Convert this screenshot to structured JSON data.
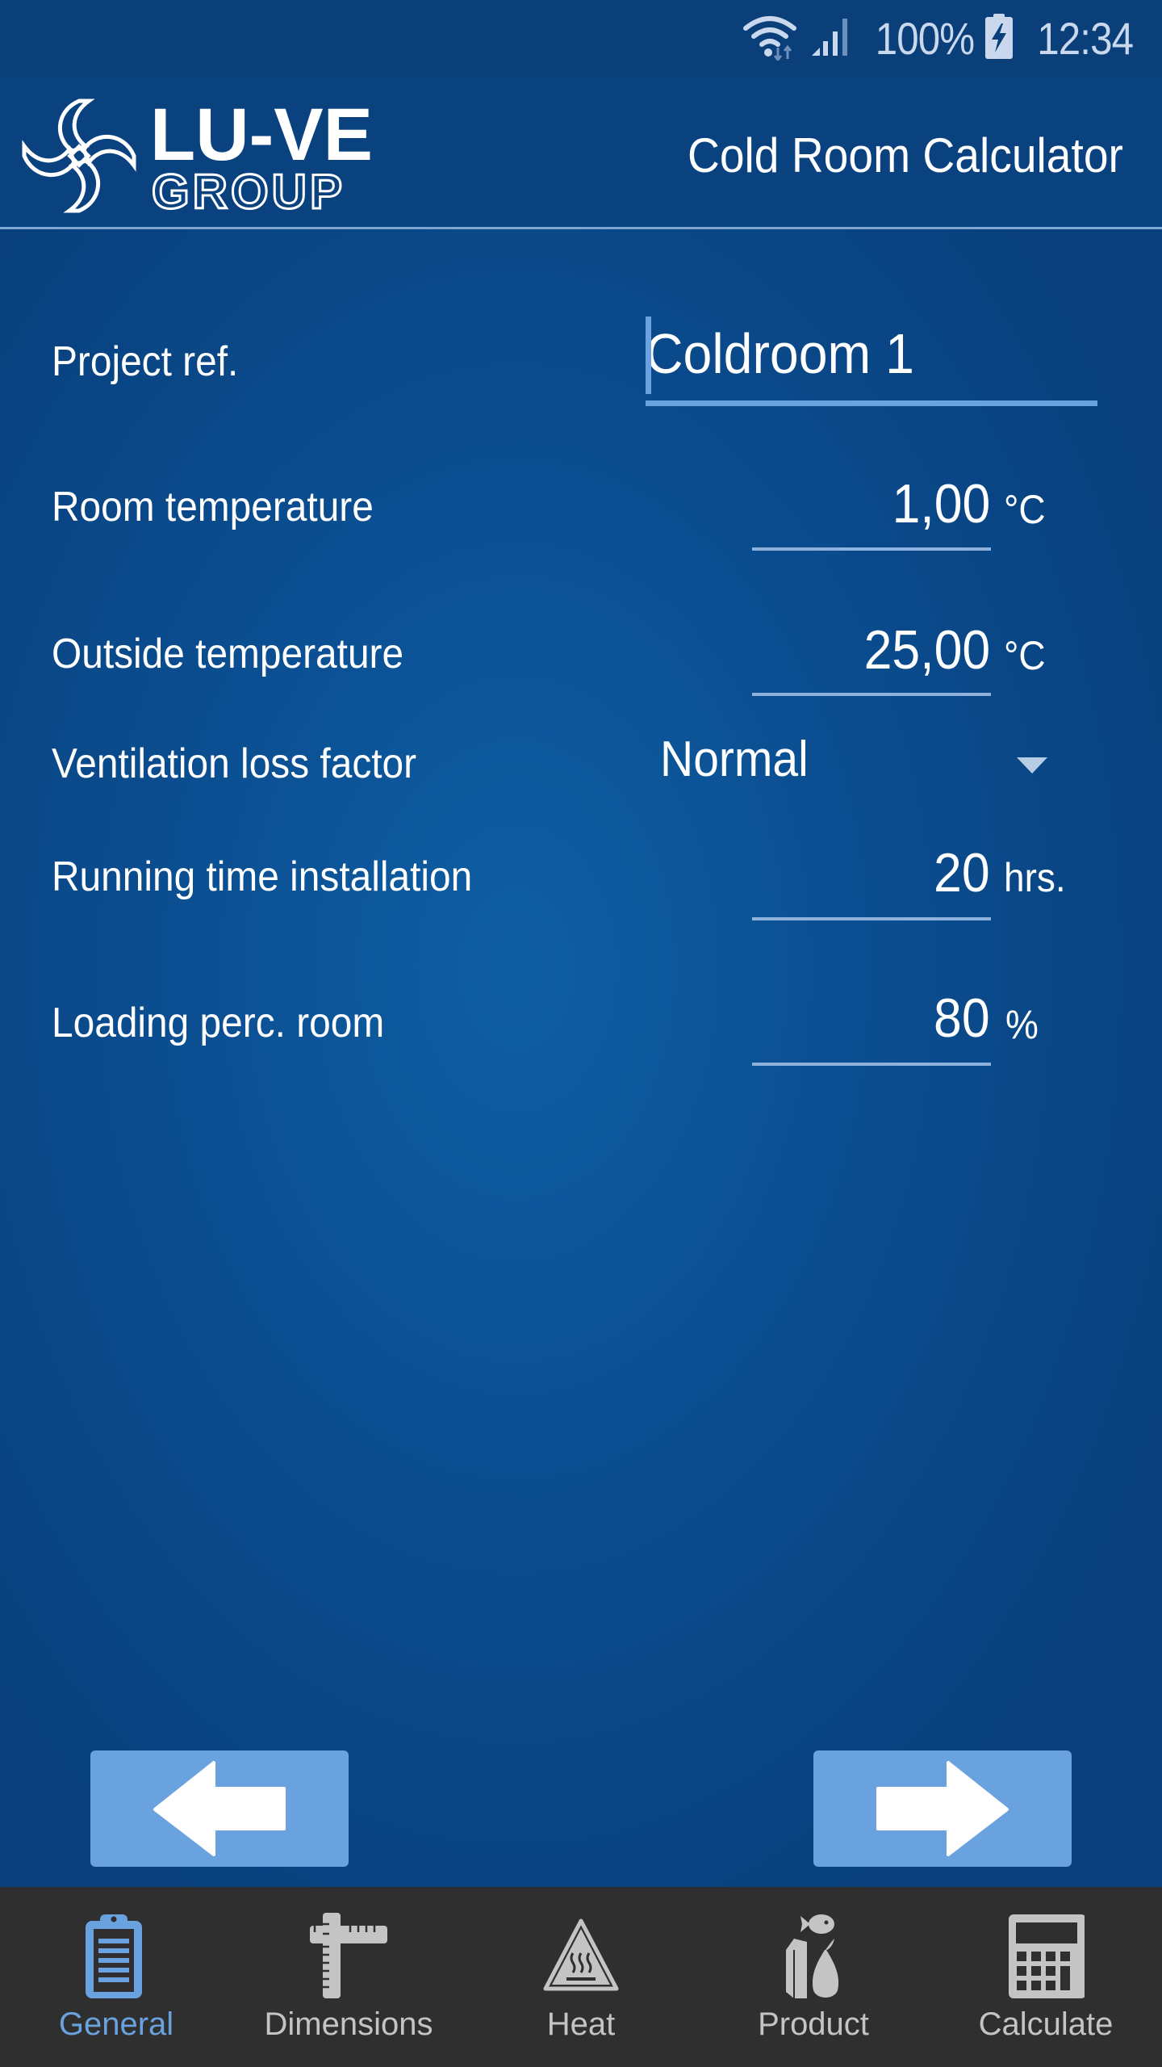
{
  "status_bar": {
    "battery_percent": "100%",
    "time": "12:34",
    "icons": [
      "wifi-icon",
      "signal-icon",
      "battery-charging-icon"
    ]
  },
  "header": {
    "logo_top": "LU-VE",
    "logo_bottom": "GROUP",
    "title": "Cold Room Calculator"
  },
  "form": {
    "project_ref": {
      "label": "Project ref.",
      "value": "Coldroom 1"
    },
    "room_temperature": {
      "label": "Room temperature",
      "value": "1,00",
      "unit": "°C"
    },
    "outside_temperature": {
      "label": "Outside temperature",
      "value": "25,00",
      "unit": "°C"
    },
    "ventilation_loss_factor": {
      "label": "Ventilation loss factor",
      "selected": "Normal"
    },
    "running_time": {
      "label": "Running time installation",
      "value": "20",
      "unit": "hrs."
    },
    "loading_perc": {
      "label": "Loading perc. room",
      "value": "80",
      "unit": "%"
    }
  },
  "navigation": {
    "back_icon": "arrow-left-icon",
    "next_icon": "arrow-right-icon"
  },
  "tabs": [
    {
      "label": "General",
      "icon": "clipboard-icon",
      "active": true
    },
    {
      "label": "Dimensions",
      "icon": "ruler-icon",
      "active": false
    },
    {
      "label": "Heat",
      "icon": "heat-warning-icon",
      "active": false
    },
    {
      "label": "Product",
      "icon": "food-product-icon",
      "active": false
    },
    {
      "label": "Calculate",
      "icon": "calculator-icon",
      "active": false
    }
  ],
  "colors": {
    "accent": "#6aa1df",
    "background": "#0b4f92",
    "tabbar": "#2f2f2f",
    "tab_inactive": "#c4c4c4"
  }
}
